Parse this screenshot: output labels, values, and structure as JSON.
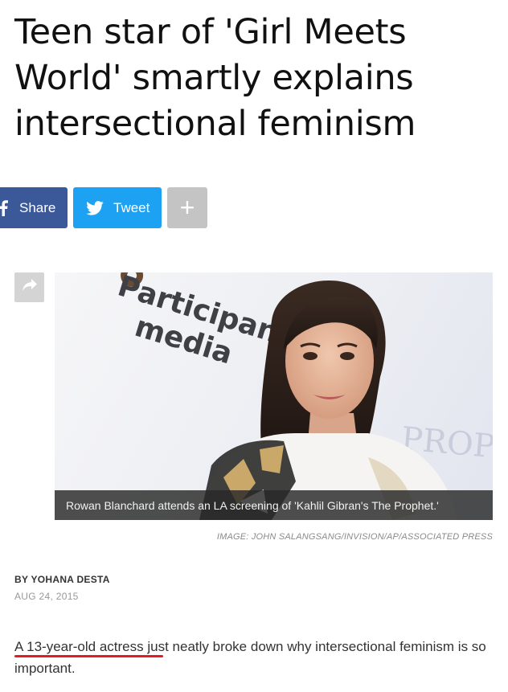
{
  "article": {
    "headline": "Teen star of 'Girl Meets World' smartly explains intersectional feminism",
    "byline": "BY YOHANA DESTA",
    "date": "AUG 24, 2015",
    "lead_paragraph": "A 13-year-old actress just neatly broke down why intersectional feminism is so important."
  },
  "share": {
    "facebook_label": "Share",
    "twitter_label": "Tweet",
    "more_label": "+",
    "facebook_color": "#3b5998",
    "twitter_color": "#1da1f2",
    "more_color": "#c4c4c4"
  },
  "image": {
    "caption": "Rowan Blanchard attends an LA screening of 'Kahlil Gibran's The Prophet.'",
    "credit": "IMAGE: JOHN SALANGSANG/INVISION/AP/ASSOCIATED PRESS",
    "backdrop_text_1": "Participant",
    "backdrop_text_2": "media",
    "backdrop_text_3": "PROPHE"
  },
  "icons": {
    "facebook": "facebook-icon",
    "twitter": "twitter-icon",
    "share_arrow": "share-arrow-icon"
  },
  "colors": {
    "underline_highlight": "#e31b23"
  }
}
